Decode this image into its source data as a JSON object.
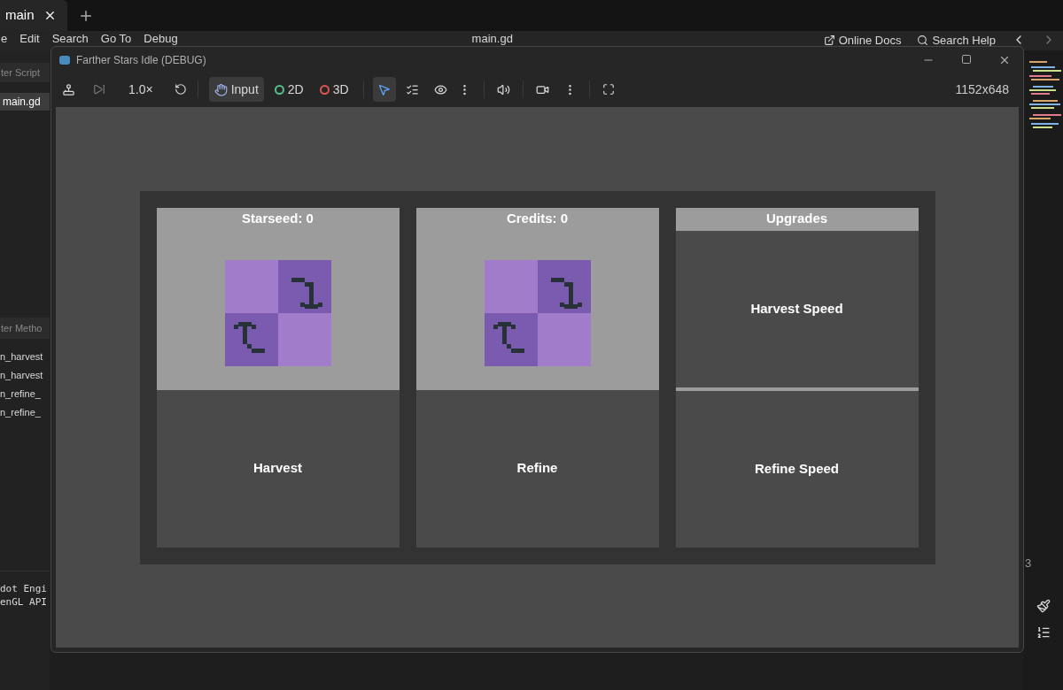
{
  "editor": {
    "tab": {
      "label": "main"
    },
    "menu": [
      "e",
      "Edit",
      "Search",
      "Go To",
      "Debug"
    ],
    "file_title": "main.gd",
    "help_links": [
      "Online Docs",
      "Search Help"
    ],
    "scripts_filter": {
      "placeholder": "ter Script"
    },
    "scripts": [
      {
        "label": "main.gd",
        "selected": true
      }
    ],
    "methods_filter": {
      "placeholder": "ter Metho"
    },
    "methods": [
      "n_harvest",
      "n_harvest",
      "n_refine_",
      "n_refine_"
    ],
    "console": [
      "dot Engi",
      "enGL API"
    ],
    "line_number": "3"
  },
  "game_window": {
    "title": "Farther Stars Idle (DEBUG)",
    "toolbar": {
      "speed": "1.0×",
      "modes": [
        {
          "kind": "input",
          "label": "Input",
          "selected": true
        },
        {
          "kind": "twod",
          "label": "2D",
          "selected": false
        },
        {
          "kind": "threed",
          "label": "3D",
          "selected": false
        }
      ],
      "tools": [
        {
          "kind": "select",
          "selected": true
        },
        {
          "kind": "list",
          "selected": false
        },
        {
          "kind": "eye",
          "selected": false
        }
      ],
      "resolution": "1152x648"
    },
    "panels": [
      {
        "kind": "resource",
        "label": "Starseed: 0",
        "button": "Harvest"
      },
      {
        "kind": "resource",
        "label": "Credits: 0",
        "button": "Refine"
      },
      {
        "kind": "upgrades",
        "label": "Upgrades",
        "buttons": [
          "Harvest Speed",
          "Refine Speed"
        ]
      }
    ]
  }
}
